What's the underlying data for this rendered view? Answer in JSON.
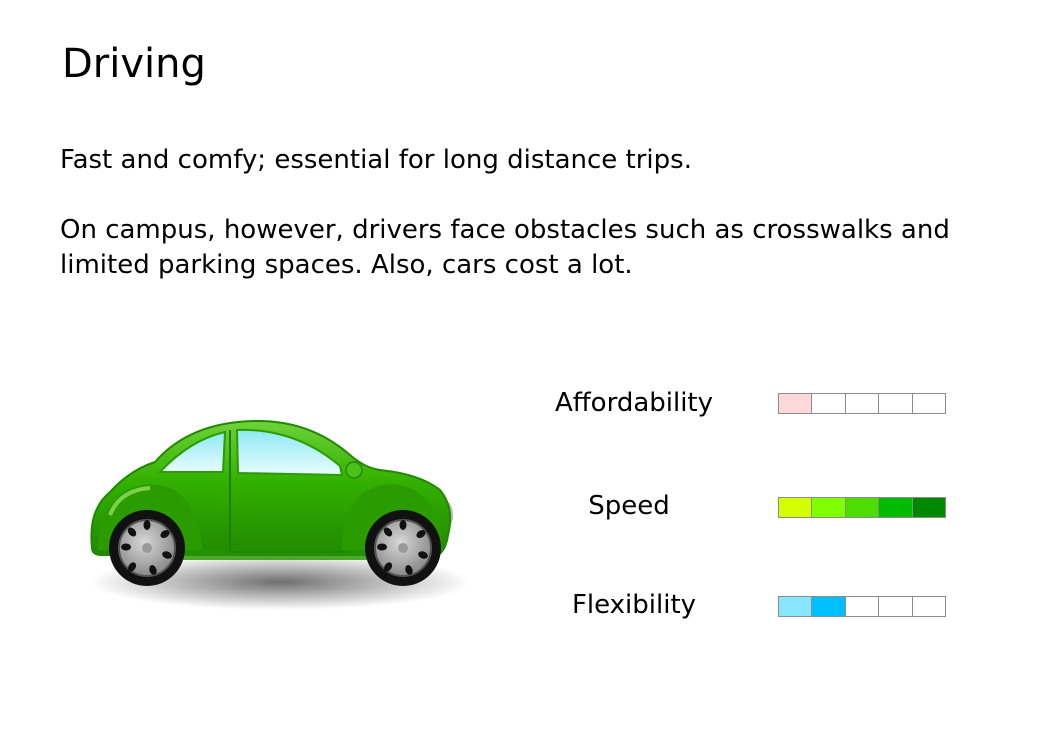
{
  "slide": {
    "title": "Driving",
    "paragraphs": [
      "Fast and comfy; essential for long distance trips.",
      "On campus, however, drivers face obstacles such as crosswalks and limited parking spaces. Also, cars cost a lot."
    ]
  },
  "illustration": {
    "icon": "car-icon",
    "body_color": "#2faa00",
    "window_color": "#c9f4fb"
  },
  "ratings": [
    {
      "label": "Affordability",
      "score": 1,
      "max": 5,
      "colors": [
        "#ffd9d9",
        "#ffffff",
        "#ffffff",
        "#ffffff",
        "#ffffff"
      ]
    },
    {
      "label": "Speed",
      "score": 5,
      "max": 5,
      "colors": [
        "#d4ff00",
        "#80ff00",
        "#4ddd00",
        "#00bb00",
        "#008800"
      ]
    },
    {
      "label": "Flexibility",
      "score": 2,
      "max": 5,
      "colors": [
        "#88e5ff",
        "#00c0ff",
        "#ffffff",
        "#ffffff",
        "#ffffff"
      ]
    }
  ]
}
